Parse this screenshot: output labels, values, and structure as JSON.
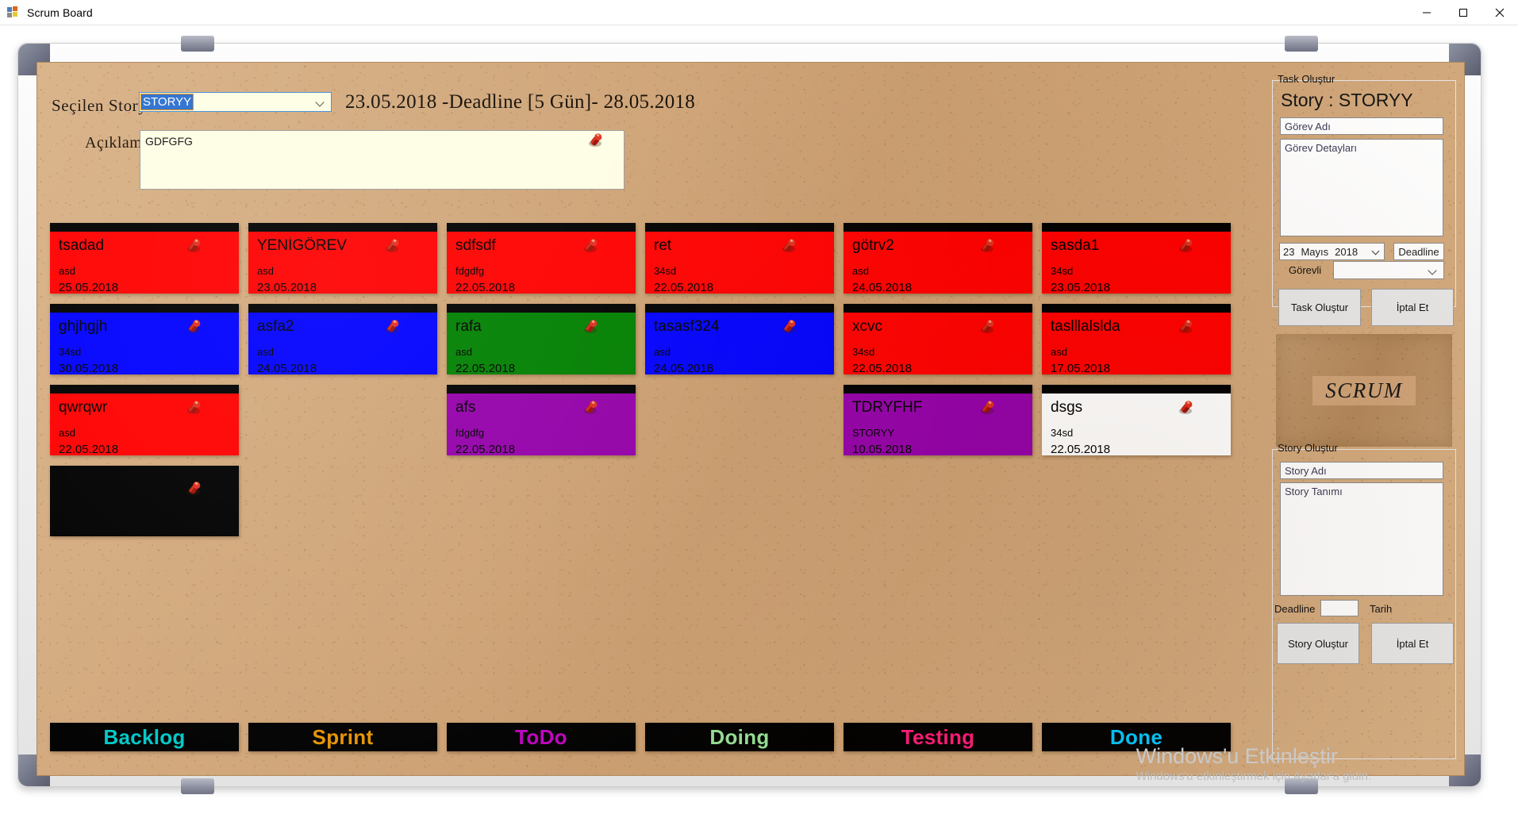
{
  "window": {
    "title": "Scrum Board",
    "icon": "app-icon",
    "minimize": "–",
    "maximize": "▭",
    "close": "✕"
  },
  "header": {
    "selected_story_label": "Seçilen Story",
    "selected_story_value": "STORYY",
    "deadline_line": "23.05.2018 -Deadline [5 Gün]- 28.05.2018",
    "description_label": "Açıklama",
    "description_value": "GDFGFG",
    "description_placeholder": ""
  },
  "columns": [
    {
      "key": "backlog",
      "label": "Backlog",
      "color": "#00c8c8"
    },
    {
      "key": "sprint",
      "label": "Sprint",
      "color": "#e59400"
    },
    {
      "key": "todo",
      "label": "ToDo",
      "color": "#c000c0"
    },
    {
      "key": "doing",
      "label": "Doing",
      "color": "#96e096"
    },
    {
      "key": "testing",
      "label": "Testing",
      "color": "#ff1a7a"
    },
    {
      "key": "done",
      "label": "Done",
      "color": "#00c8ff"
    }
  ],
  "cards": {
    "backlog": [
      {
        "title": "tsadad",
        "detail": "asd",
        "date": "25.05.2018",
        "color": "#ff0000",
        "text": "#000000"
      },
      {
        "title": "ghjhgjh",
        "detail": "34sd",
        "date": "30.05.2018",
        "color": "#0000ff",
        "text": "#000000"
      },
      {
        "title": "qwrqwr",
        "detail": "asd",
        "date": "22.05.2018",
        "color": "#ff0000",
        "text": "#000000"
      },
      {
        "title": "",
        "detail": "",
        "date": "",
        "color": "#000000",
        "text": "#000000",
        "blank": true
      }
    ],
    "sprint": [
      {
        "title": "YENİGÖREV",
        "detail": "asd",
        "date": "23.05.2018",
        "color": "#ff0000",
        "text": "#000000"
      },
      {
        "title": "asfa2",
        "detail": "asd",
        "date": "24.05.2018",
        "color": "#0000ff",
        "text": "#000000"
      }
    ],
    "todo": [
      {
        "title": "sdfsdf",
        "detail": "fdgdfg",
        "date": "22.05.2018",
        "color": "#ff0000",
        "text": "#000000"
      },
      {
        "title": "rafa",
        "detail": "asd",
        "date": "22.05.2018",
        "color": "#008000",
        "text": "#000000"
      },
      {
        "title": "afs",
        "detail": "fdgdfg",
        "date": "22.05.2018",
        "color": "#9400aa",
        "text": "#000000"
      }
    ],
    "doing": [
      {
        "title": "ret",
        "detail": "34sd",
        "date": "22.05.2018",
        "color": "#ff0000",
        "text": "#000000"
      },
      {
        "title": "tasasf324",
        "detail": "asd",
        "date": "24.05.2018",
        "color": "#0000ff",
        "text": "#000000"
      }
    ],
    "testing": [
      {
        "title": "götrv2",
        "detail": "asd",
        "date": "24.05.2018",
        "color": "#ff0000",
        "text": "#000000"
      },
      {
        "title": "xcvc",
        "detail": "34sd",
        "date": "22.05.2018",
        "color": "#ff0000",
        "text": "#000000"
      },
      {
        "title": "TDRYFHF",
        "detail": "STORYY",
        "date": "10.05.2018",
        "color": "#9400aa",
        "text": "#000000"
      }
    ],
    "done": [
      {
        "title": "sasda1",
        "detail": "34sd",
        "date": "23.05.2018",
        "color": "#ff0000",
        "text": "#000000"
      },
      {
        "title": "taslllalslda",
        "detail": "asd",
        "date": "17.05.2018",
        "color": "#ff0000",
        "text": "#000000"
      },
      {
        "title": "dsgs",
        "detail": "34sd",
        "date": "22.05.2018",
        "color": "#ffffff",
        "text": "#000000"
      }
    ]
  },
  "sidebar": {
    "task_group": {
      "title": "Task Oluştur",
      "story_heading": "Story : STORYY",
      "task_name_placeholder": "Görev Adı",
      "task_detail_placeholder": "Görev Detayları",
      "date_day": "23",
      "date_month": "Mayıs",
      "date_year": "2018",
      "deadline_label": "Deadline",
      "assignee_label": "Görevli",
      "assignee_value": "",
      "create_button": "Task Oluştur",
      "cancel_button": "İptal Et"
    },
    "logo_text": "SCRUM",
    "story_group": {
      "title": "Story Oluştur",
      "story_name_placeholder": "Story Adı",
      "story_detail_placeholder": "Story Tanımı",
      "deadline_label": "Deadline",
      "deadline_value": "",
      "date_label": "Tarih",
      "create_button": "Story Oluştur",
      "cancel_button": "İptal Et"
    }
  },
  "watermark": {
    "line1": "Windows'u Etkinleştir",
    "line2": "Windows'u etkinleştirmek için Ayarlar'a gidin."
  }
}
